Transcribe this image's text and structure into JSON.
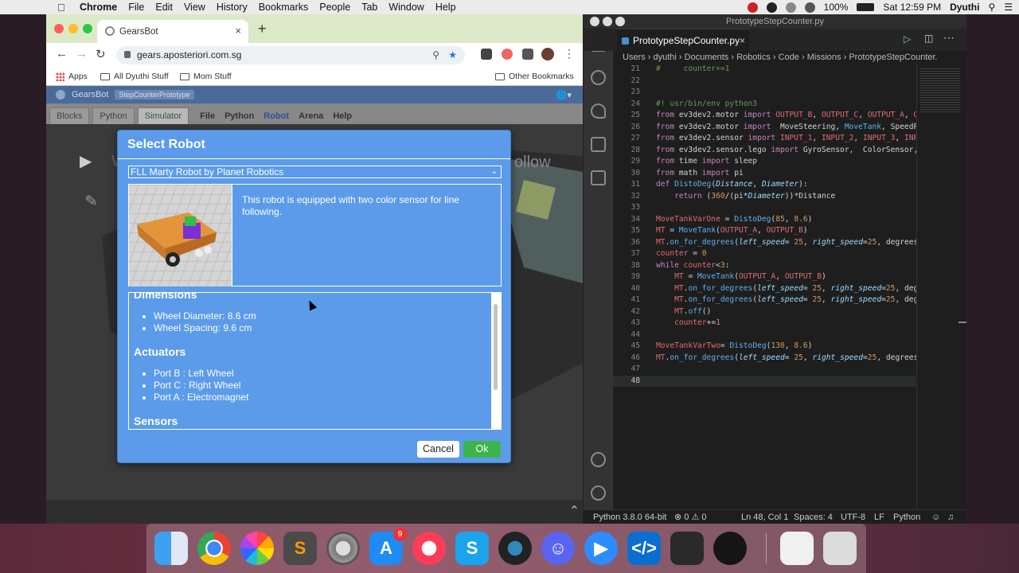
{
  "menubar": {
    "app_name": "Chrome",
    "items": [
      "File",
      "Edit",
      "View",
      "History",
      "Bookmarks",
      "People",
      "Tab",
      "Window",
      "Help"
    ],
    "battery": "100%",
    "clock": "Sat 12:59 PM",
    "user": "Dyuthi"
  },
  "chrome": {
    "tab_title": "GearsBot",
    "tab_close": "×",
    "new_tab": "+",
    "url": "gears.aposteriori.com.sg",
    "bookmarks": [
      "Apps",
      "All Dyuthi Stuff",
      "Mom Stuff"
    ],
    "other_bookmarks": "Other Bookmarks"
  },
  "gearsbot": {
    "brand": "GearsBot",
    "project_badge": "StepCounterPrototype",
    "tabs": [
      "Blocks",
      "Python",
      "Simulator"
    ],
    "menu": [
      "File",
      "Python",
      "Robot",
      "Arena",
      "Help"
    ],
    "bg_text_left": "W",
    "bg_text_right": "ollow"
  },
  "dialog": {
    "title": "Select Robot",
    "selected_robot": "FLL Marty Robot by Planet Robotics",
    "description": "This robot is equipped with two color sensor for line following.",
    "sections": [
      {
        "heading": "Dimensions",
        "items": [
          "Wheel Diameter: 8.6 cm",
          "Wheel Spacing: 9.6 cm"
        ]
      },
      {
        "heading": "Actuators",
        "items": [
          "Port B : Left Wheel",
          "Port C : Right Wheel",
          "Port A : Electromagnet"
        ]
      },
      {
        "heading": "Sensors",
        "items": []
      }
    ],
    "cancel_label": "Cancel",
    "ok_label": "Ok"
  },
  "vscode": {
    "window_title": "PrototypeStepCounter.py",
    "tab_label": "PrototypeStepCounter.py",
    "breadcrumb": [
      "Users",
      "dyuthi",
      "Documents",
      "Robotics",
      "Code",
      "Missions",
      "PrototypeStepCounter."
    ],
    "lines": [
      {
        "n": "21",
        "t": "#     counter+=1"
      },
      {
        "n": "22",
        "t": ""
      },
      {
        "n": "23",
        "t": ""
      },
      {
        "n": "24",
        "t": "#! usr/bin/env python3"
      },
      {
        "n": "25",
        "t": "from ev3dev2.motor import OUTPUT_B, OUTPUT_C, OUTPUT_A, O"
      },
      {
        "n": "26",
        "t": "from ev3dev2.motor import  MoveSteering, MoveTank, SpeedP"
      },
      {
        "n": "27",
        "t": "from ev3dev2.sensor import INPUT_1, INPUT_2, INPUT_3, INP"
      },
      {
        "n": "28",
        "t": "from ev3dev2.sensor.lego import GyroSensor,  ColorSensor,"
      },
      {
        "n": "29",
        "t": "from time import sleep"
      },
      {
        "n": "30",
        "t": "from math import pi"
      },
      {
        "n": "31",
        "t": "def DistoDeg(Distance, Diameter):"
      },
      {
        "n": "32",
        "t": "    return (360/(pi*Diameter))*Distance"
      },
      {
        "n": "33",
        "t": ""
      },
      {
        "n": "34",
        "t": "MoveTankVarOne = DistoDeg(85, 8.6)"
      },
      {
        "n": "35",
        "t": "MT = MoveTank(OUTPUT_A, OUTPUT_B)"
      },
      {
        "n": "36",
        "t": "MT.on_for_degrees(left_speed= 25, right_speed=25, degrees"
      },
      {
        "n": "37",
        "t": "counter = 0"
      },
      {
        "n": "38",
        "t": "while counter<3:"
      },
      {
        "n": "39",
        "t": "    MT = MoveTank(OUTPUT_A, OUTPUT_B)"
      },
      {
        "n": "40",
        "t": "    MT.on_for_degrees(left_speed= 25, right_speed=25, deg"
      },
      {
        "n": "41",
        "t": "    MT.on_for_degrees(left_speed= 25, right_speed=25, deg"
      },
      {
        "n": "42",
        "t": "    MT.off()"
      },
      {
        "n": "43",
        "t": "    counter+=1"
      },
      {
        "n": "44",
        "t": ""
      },
      {
        "n": "45",
        "t": "MoveTankVarTwo= DistoDeg(130, 8.6)"
      },
      {
        "n": "46",
        "t": "MT.on_for_degrees(left_speed= 25, right_speed=25, degrees"
      },
      {
        "n": "47",
        "t": ""
      },
      {
        "n": "48",
        "t": ""
      }
    ],
    "status": {
      "interpreter": "Python 3.8.0 64-bit",
      "problems": "⊗ 0 ⚠ 0",
      "position": "Ln 48, Col 1",
      "spaces": "Spaces: 4",
      "encoding": "UTF-8",
      "eol": "LF",
      "language": "Python"
    }
  },
  "dock": {
    "apps": [
      "finder",
      "chrome",
      "photos",
      "sublime-text",
      "system-preferences",
      "app-store",
      "music",
      "skype",
      "quicktime",
      "discord",
      "zoom",
      "vscode",
      "game",
      "obs",
      "document",
      "trash"
    ],
    "app_store_badge": "9"
  },
  "colors": {
    "dialog_bg": "#5b9bea",
    "ok_button": "#3cb44a",
    "vscode_bg": "#1e1e1e",
    "tab_bar": "#dbe9c8"
  }
}
